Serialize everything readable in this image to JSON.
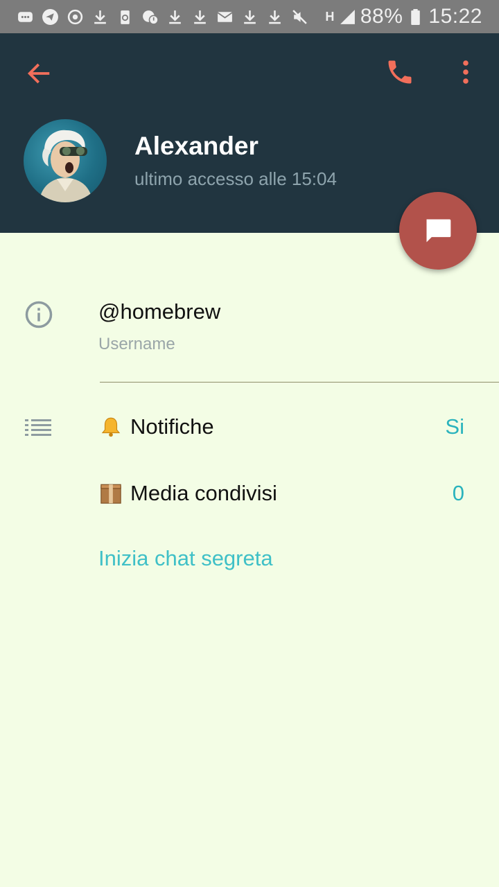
{
  "status_bar": {
    "battery_percent": "88%",
    "time": "15:22",
    "network": "H",
    "icons": [
      "messages-icon",
      "telegram-icon",
      "sync-icon",
      "download-icon",
      "recycle-icon",
      "chat-alert-icon",
      "download-icon",
      "download-icon",
      "mail-icon",
      "download-icon",
      "download-icon",
      "mute-icon",
      "signal-icon",
      "battery-icon"
    ]
  },
  "header": {
    "name": "Alexander",
    "last_seen": "ultimo accesso alle 15:04",
    "accent_color": "#f26f5b",
    "background_color": "#213540"
  },
  "profile": {
    "username": "@homebrew",
    "username_label": "Username"
  },
  "settings": {
    "notifications_label": "Notifiche",
    "notifications_emoji": "bell",
    "notifications_value": "Si",
    "media_label": "Media condivisi",
    "media_emoji": "package",
    "media_value": "0",
    "secret_chat_label": "Inizia chat segreta"
  },
  "colors": {
    "fab": "#b2524b",
    "link": "#3fc0c7",
    "content_bg": "#f3fde5"
  }
}
